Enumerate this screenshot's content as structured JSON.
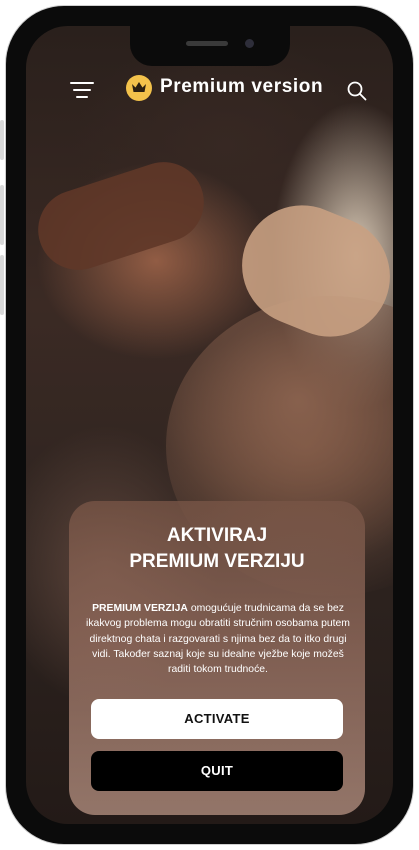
{
  "header": {
    "title": "Premium version"
  },
  "card": {
    "title_line1": "AKTIVIRAJ",
    "title_line2": "PREMIUM VERZIJU",
    "description_bold": "PREMIUM VERZIJA",
    "description_rest": " omogućuje trudnicama da se bez ikakvog problema mogu obratiti stručnim osobama putem direktnog chata i razgovarati s njima bez da to itko drugi vidi. Također saznaj koje su idealne vježbe koje možeš raditi tokom trudnoće.",
    "activate_label": "ACTIVATE",
    "quit_label": "QUIT"
  },
  "icons": {
    "menu": "menu-icon",
    "crown": "crown-icon",
    "search": "search-icon"
  },
  "colors": {
    "accent": "#f3c24b",
    "button_light": "#ffffff",
    "button_dark": "#000000"
  }
}
